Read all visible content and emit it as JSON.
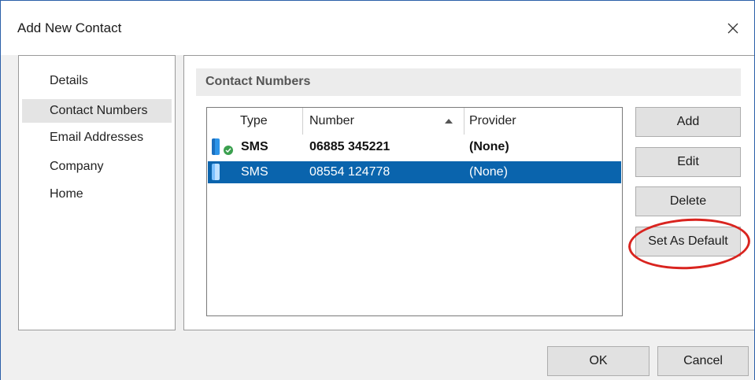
{
  "window": {
    "title": "Add New Contact"
  },
  "nav": {
    "items": [
      {
        "label": "Details",
        "selected": false
      },
      {
        "label": "Contact Numbers",
        "selected": true
      },
      {
        "label": "Email Addresses",
        "selected": false
      },
      {
        "label": "Company",
        "selected": false
      },
      {
        "label": "Home",
        "selected": false
      }
    ]
  },
  "section": {
    "title": "Contact Numbers"
  },
  "list": {
    "columns": [
      "Type",
      "Number",
      "Provider"
    ],
    "sort_column": "Number",
    "sort_direction": "ascending",
    "rows": [
      {
        "type": "SMS",
        "number": "06885 345221",
        "provider": "(None)",
        "is_default": true,
        "selected": false,
        "icon": "mobile-phone-icon"
      },
      {
        "type": "SMS",
        "number": "08554 124778",
        "provider": "(None)",
        "is_default": false,
        "selected": true,
        "icon": "mobile-phone-icon"
      }
    ]
  },
  "actions": {
    "add_label": "Add",
    "edit_label": "Edit",
    "delete_label": "Delete",
    "set_default_label": "Set As Default"
  },
  "footer": {
    "ok_label": "OK",
    "cancel_label": "Cancel"
  },
  "colors": {
    "selection": "#0a64ad",
    "highlight_ring": "#d9241f",
    "default_badge": "#3ba04f"
  }
}
